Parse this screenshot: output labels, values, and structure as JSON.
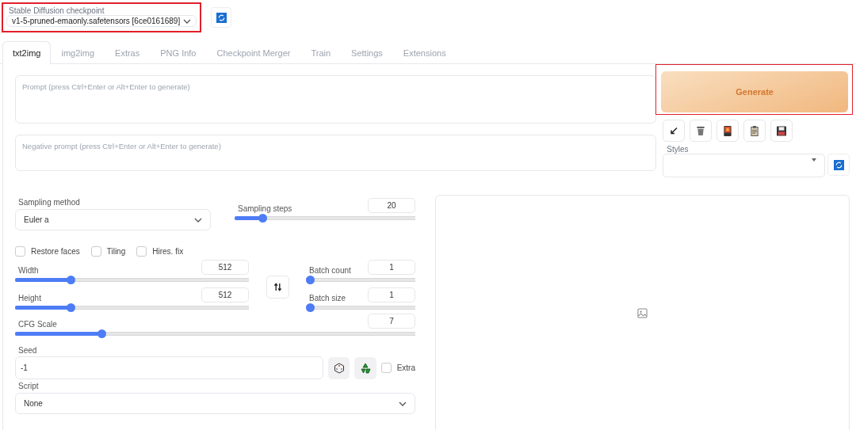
{
  "checkpoint": {
    "label": "Stable Diffusion checkpoint",
    "value": "v1-5-pruned-emaonly.safetensors [6ce0161689]",
    "highlighted": true
  },
  "tabs": [
    {
      "label": "txt2img",
      "selected": true
    },
    {
      "label": "img2img",
      "selected": false
    },
    {
      "label": "Extras",
      "selected": false
    },
    {
      "label": "PNG Info",
      "selected": false
    },
    {
      "label": "Checkpoint Merger",
      "selected": false
    },
    {
      "label": "Train",
      "selected": false
    },
    {
      "label": "Settings",
      "selected": false
    },
    {
      "label": "Extensions",
      "selected": false
    }
  ],
  "prompt": {
    "placeholder": "Prompt (press Ctrl+Enter or Alt+Enter to generate)"
  },
  "negative_prompt": {
    "placeholder": "Negative prompt (press Ctrl+Enter or Alt+Enter to generate)"
  },
  "generate_button": {
    "label": "Generate",
    "highlighted": true
  },
  "tool_buttons": [
    {
      "kind": "arrow"
    },
    {
      "kind": "trash"
    },
    {
      "kind": "card"
    },
    {
      "kind": "clipboard"
    },
    {
      "kind": "save"
    }
  ],
  "styles": {
    "label": "Styles"
  },
  "sampling_method": {
    "label": "Sampling method",
    "value": "Euler a"
  },
  "sampling_steps": {
    "label": "Sampling steps",
    "value": "20",
    "level": 0.14
  },
  "checkboxes": [
    {
      "label": "Restore faces",
      "checked": false
    },
    {
      "label": "Tiling",
      "checked": false
    },
    {
      "label": "Hires. fix",
      "checked": false
    }
  ],
  "size_sliders": [
    {
      "label": "Width",
      "value": "512",
      "level": 0.23
    },
    {
      "label": "Height",
      "value": "512",
      "level": 0.23
    }
  ],
  "batch_sliders": [
    {
      "label": "Batch count",
      "value": "1",
      "level": 0
    },
    {
      "label": "Batch size",
      "value": "1",
      "level": 0
    }
  ],
  "cfg_scale": {
    "label": "CFG Scale",
    "value": "7",
    "level": 0.21
  },
  "seed": {
    "label": "Seed",
    "value": "-1"
  },
  "extra": {
    "label": "Extra",
    "checked": false
  },
  "script": {
    "label": "Script",
    "value": "None"
  }
}
